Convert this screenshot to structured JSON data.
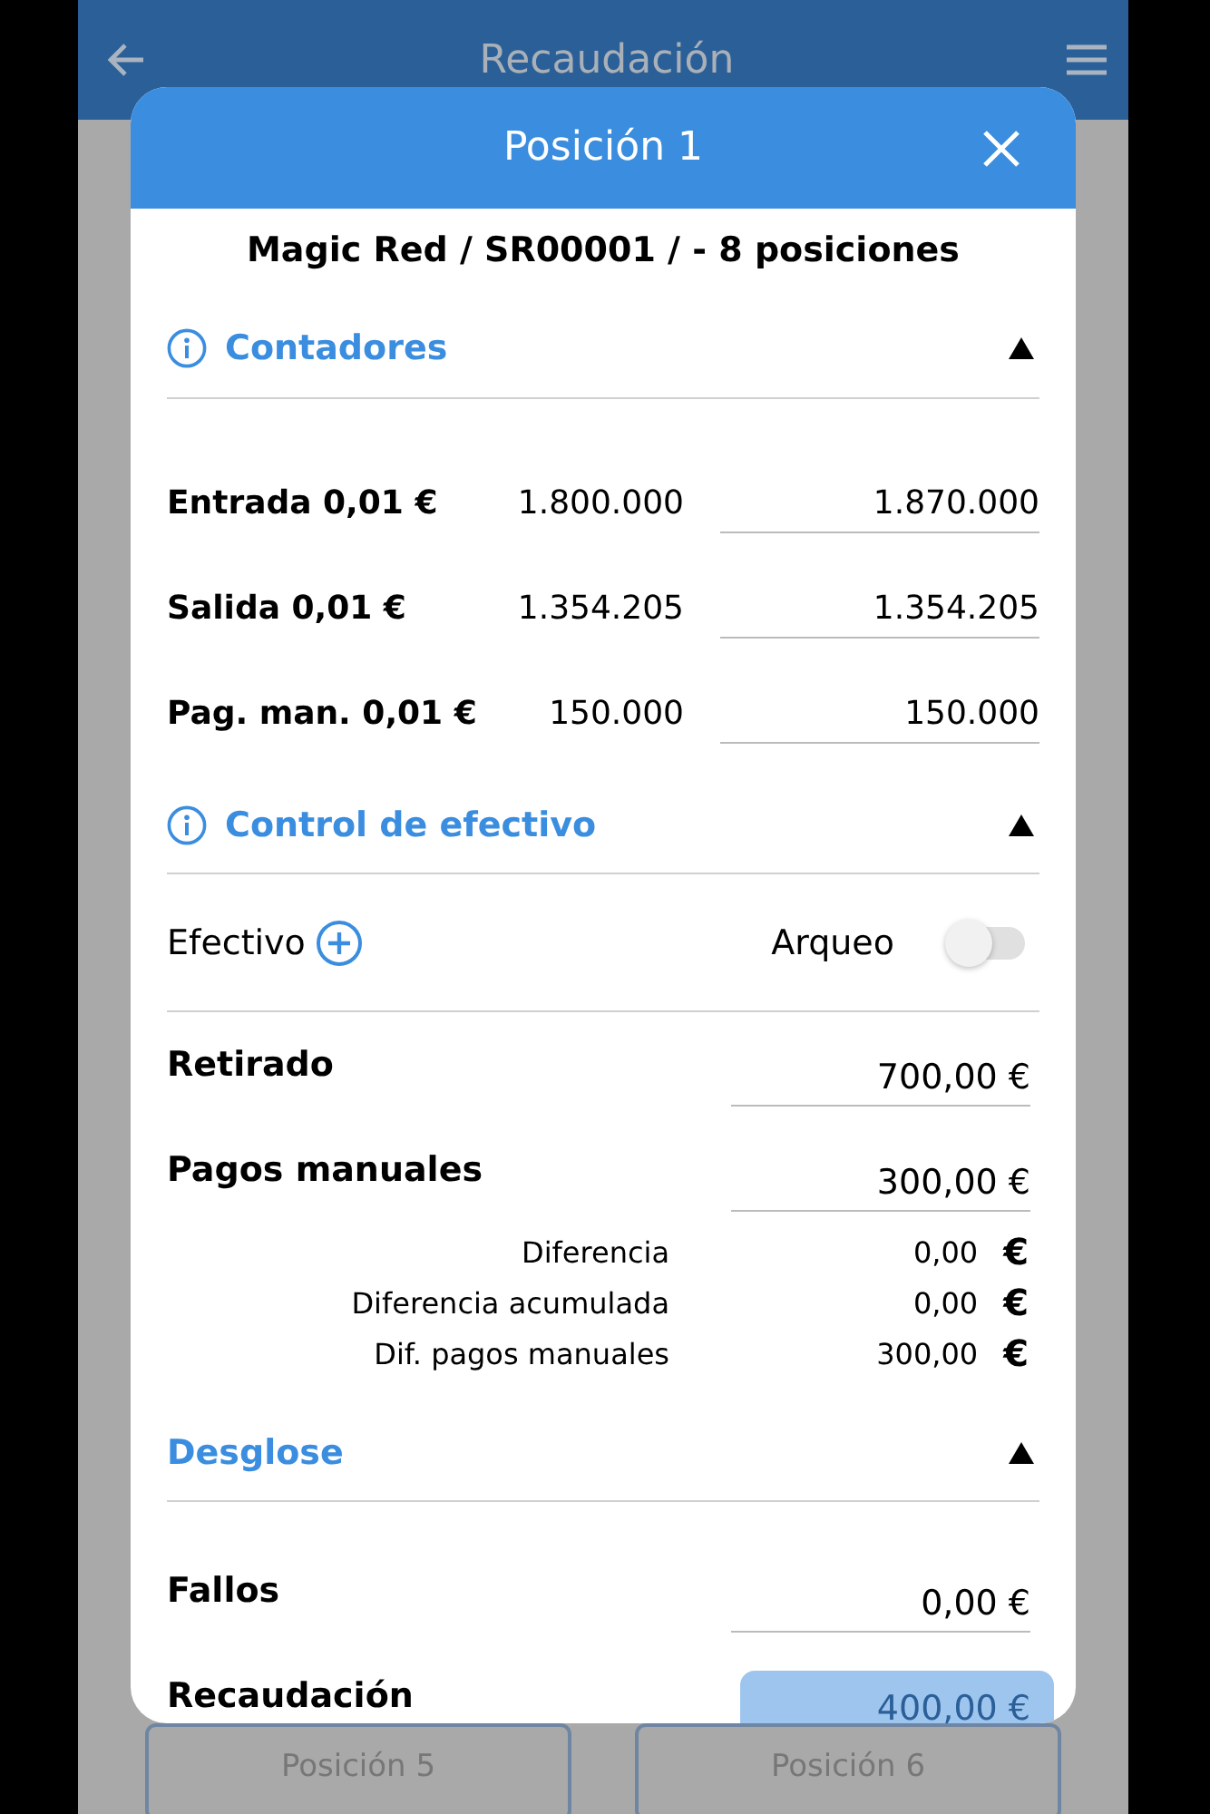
{
  "app_bar": {
    "title": "Recaudación"
  },
  "background_buttons": [
    {
      "label": "Posición 5"
    },
    {
      "label": "Posición 6"
    }
  ],
  "dialog": {
    "title": "Posición 1",
    "subtitle": "Magic Red / SR00001 / - 8 posiciones",
    "sections": [
      {
        "kind": "counters",
        "title": "Contadores",
        "expanded": true,
        "rows": [
          {
            "label": "Entrada 0,01 €",
            "reading": "1.800.000",
            "value": "1.870.000"
          },
          {
            "label": "Salida 0,01 €",
            "reading": "1.354.205",
            "value": "1.354.205"
          },
          {
            "label": "Pag. man. 0,01 €",
            "reading": "150.000",
            "value": "150.000"
          }
        ]
      },
      {
        "kind": "cash",
        "title": "Control de efectivo",
        "expanded": true,
        "cash_label": "Efectivo",
        "count_label": "Arqueo",
        "count_on": false,
        "fields": [
          {
            "label": "Retirado",
            "value": "700,00 €"
          },
          {
            "label": "Pagos manuales",
            "value": "300,00 €"
          }
        ],
        "summary": [
          {
            "label": "Diferencia",
            "amount": "0,00",
            "currency": "€"
          },
          {
            "label": "Diferencia acumulada",
            "amount": "0,00",
            "currency": "€"
          },
          {
            "label": "Dif. pagos manuales",
            "amount": "300,00",
            "currency": "€"
          }
        ]
      },
      {
        "kind": "breakdown",
        "title": "Desglose",
        "expanded": true,
        "fields": [
          {
            "label": "Fallos",
            "value": "0,00 €",
            "highlighted": false
          },
          {
            "label": "Recaudación",
            "value": "400,00 €",
            "highlighted": true
          }
        ]
      }
    ]
  }
}
